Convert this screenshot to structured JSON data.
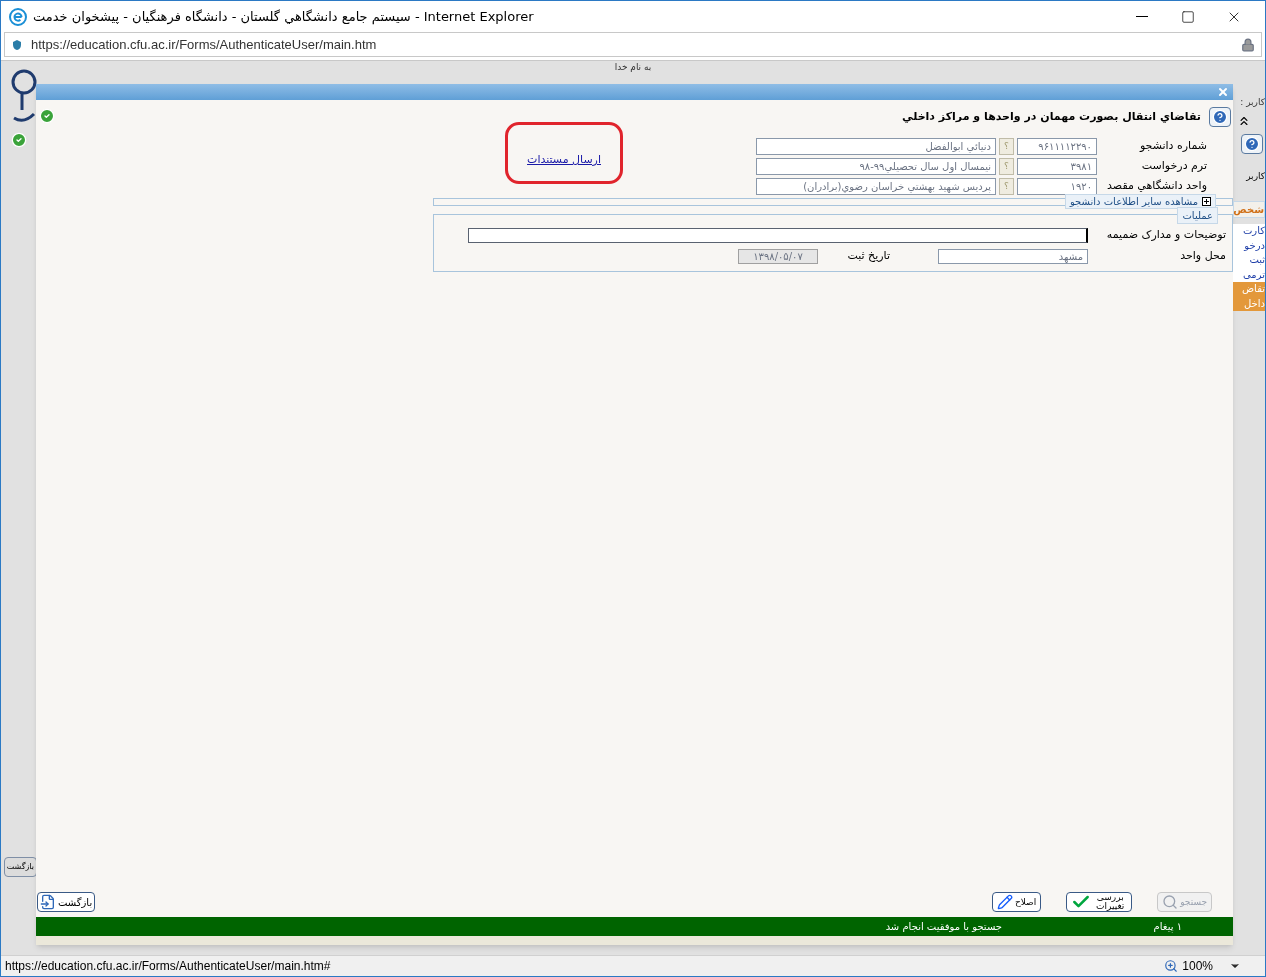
{
  "window": {
    "title": "سيستم جامع دانشگاهي گلستان - دانشگاه فرهنگيان - پيشخوان خدمت - Internet Explorer"
  },
  "address_bar": {
    "url": "https://education.cfu.ac.ir/Forms/AuthenticateUser/main.htm"
  },
  "background_page": {
    "header_text": "به نام خدا",
    "user_label": "کاربر :",
    "side_label": "کاربر",
    "back_button": "بازگشت",
    "menu_header": "شخص",
    "menu_items": [
      {
        "label": "کارت",
        "selected": false
      },
      {
        "label": "درخو",
        "selected": false
      },
      {
        "label": "ثبت",
        "selected": false
      },
      {
        "label": "ترمی",
        "selected": false
      },
      {
        "label": "تقاض",
        "selected": true
      },
      {
        "label": "داخل",
        "selected": true
      }
    ]
  },
  "dialog": {
    "title": "تقاضاي انتقال بصورت مهمان در واحدها و مراكز داخلي",
    "fields": [
      {
        "label": "شماره دانشجو",
        "code": "۹۶۱۱۱۱۲۲۹۰",
        "lookup": "؟",
        "name": "دنيائي ابوالفضل"
      },
      {
        "label": "ترم درخواست",
        "code": "۳۹۸۱",
        "lookup": "؟",
        "name": "نيمسال اول سال تحصيلي۹۹-۹۸"
      },
      {
        "label": "واحد دانشگاهي مقصد",
        "code": "۱۹۲۰",
        "lookup": "؟",
        "name": "پرديس شهيد بهشتي خراسان رضوي(برادران)"
      }
    ],
    "link": "ارسال مستندات",
    "student_info": {
      "title": "مشاهده سایر اطلاعات دانشجو",
      "expanded": false
    },
    "operations": {
      "title": "عملیات",
      "description_label": "توضیحات و مدارک ضمیمه",
      "unit_place_label": "محل واحد",
      "unit_place_value": "مشهد",
      "date_label": "تاریخ ثبت",
      "date_value": "۱۳۹۸/۰۵/۰۷"
    },
    "back_button": "بازگشت",
    "buttons": [
      {
        "kind": "search",
        "label": "جستجو",
        "disabled": true
      },
      {
        "kind": "review",
        "label": "بررسی تغییرات",
        "disabled": false
      },
      {
        "kind": "edit",
        "label": "اصلاح",
        "disabled": false
      }
    ],
    "message_bar": {
      "count": "۱ پیغام",
      "text": "جستجو با موفقيت انجام شد"
    }
  },
  "status_bar": {
    "url": "https://education.cfu.ac.ir/Forms/AuthenticateUser/main.htm#",
    "zoom": "100%"
  }
}
